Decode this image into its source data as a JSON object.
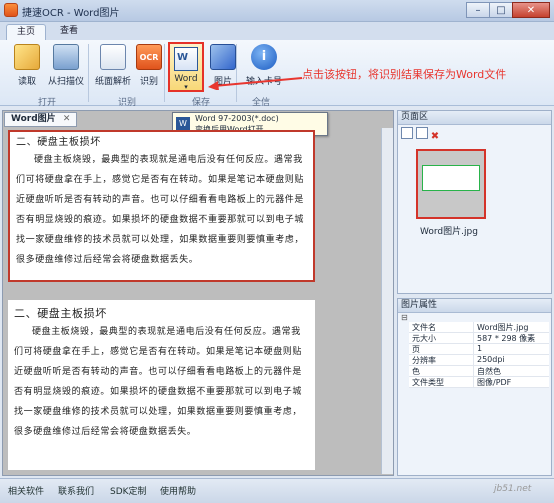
{
  "window": {
    "title": "捷速OCR - Word图片"
  },
  "tabs": [
    "主页",
    "查看"
  ],
  "ribbon": {
    "read": "读取",
    "from_scanner": "从扫描仪",
    "open_group": "打开",
    "layout_parse": "纸面解析",
    "recognize": "识别",
    "recognize_group": "识别",
    "word": "Word",
    "picture": "图片",
    "save_group": "保存",
    "enter_serial": "输入卡号",
    "full_info_group": "全信"
  },
  "tooltip": {
    "title": "Word 97-2003(*.doc)",
    "desc": "变换后用Word打开"
  },
  "annotation": "点击该按钮，将识别结果保存为Word文件",
  "document": {
    "tab_label": "Word图片",
    "image_heading": "二、硬盘主板损坏",
    "image_body": "硬盘主板烧毁，最典型的表现就是通电后没有任何反应。遇常我们可将硬盘拿在手上，感觉它是否有在转动。如果是笔记本硬盘则贴近硬盘听听是否有转动的声音。也可以仔细看看电路板上的元器件是否有明显烧毁的痕迹。如果损坏的硬盘数据不重要那就可以到电子城找一家硬盘维修的技术员就可以处理，如果数据重要则要慎重考虑，很多硬盘维修过后经常会将硬盘数据丢失。",
    "result_heading": "二、硬盘主板损坏",
    "result_body": "硬盘主板烧毁，最典型的表现就是通电后没有任何反应。遇常我们可将硬盘拿在手上，感觉它是否有在转动。如果是笔记本硬盘则贴近硬盘听听是否有转动的声音。也可以仔细看看电路板上的元器件是否有明显烧毁的痕迹。如果损坏的硬盘数据不重要那就可以到电子城找一家硬盘维修的技术员就可以处理，如果数据重要则要慎重考虑，很多硬盘维修过后经常会将硬盘数据丢失。"
  },
  "page_panel": {
    "title": "页面区",
    "thumb_label": "Word图片.jpg"
  },
  "props_panel": {
    "title": "图片属性",
    "rows": [
      {
        "k": "文件名",
        "v": "Word图片.jpg"
      },
      {
        "k": "元大小",
        "v": "587 * 298 像素"
      },
      {
        "k": "页",
        "v": "1"
      },
      {
        "k": "分辨率",
        "v": "250dpi"
      },
      {
        "k": "色",
        "v": "自然色"
      },
      {
        "k": "文件类型",
        "v": "图像/PDF"
      }
    ]
  },
  "statusbar": {
    "items": [
      "相关软件",
      "联系我们",
      "SDK定制",
      "使用帮助"
    ],
    "watermark": "jb51.net"
  },
  "colors": {
    "annotation_red": "#e8362f",
    "highlight_border": "#e53228",
    "doc_border": "#c0392b"
  }
}
